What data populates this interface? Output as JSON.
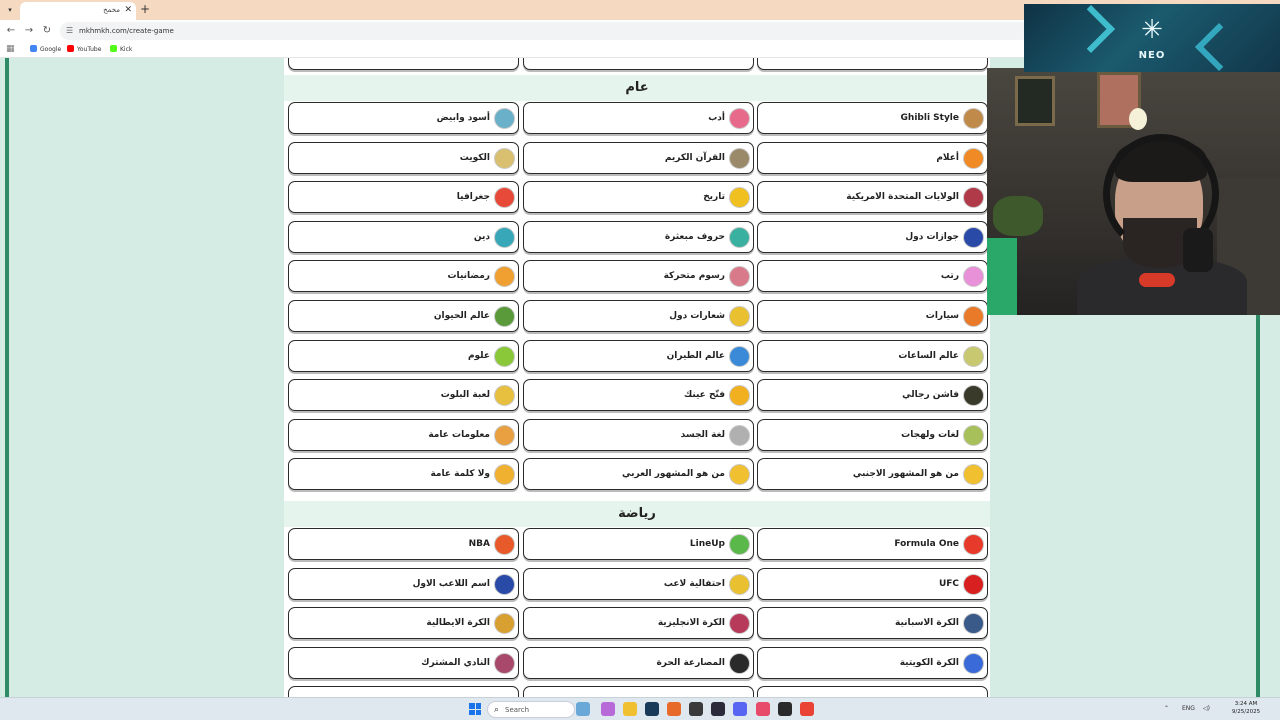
{
  "browser": {
    "tab_title": "مخمخ",
    "url": "mkhmkh.com/create-game",
    "bookmarks": [
      {
        "label": "Google",
        "color": "#4285f4"
      },
      {
        "label": "YouTube",
        "color": "#ff0000"
      },
      {
        "label": "Kick",
        "color": "#53fc18"
      }
    ]
  },
  "sections": [
    {
      "title": "عام",
      "cards": [
        {
          "label": "Ghibli Style",
          "icon": "ghibli-icon",
          "color": "#c08a4a"
        },
        {
          "label": "أدب",
          "icon": "literature-icon",
          "color": "#e86a8a"
        },
        {
          "label": "أسود وابيض",
          "icon": "black-white-icon",
          "color": "#6ab0c8"
        },
        {
          "label": "أعلام",
          "icon": "flags-icon",
          "color": "#f08a24"
        },
        {
          "label": "القرآن الكريم",
          "icon": "quran-icon",
          "color": "#9a8a6a"
        },
        {
          "label": "الكويت",
          "icon": "kuwait-icon",
          "color": "#d8c070"
        },
        {
          "label": "الولايات المتحدة الامريكية",
          "icon": "usa-flag-icon",
          "color": "#b03a48"
        },
        {
          "label": "تاريخ",
          "icon": "history-icon",
          "color": "#f0c020"
        },
        {
          "label": "جغرافيا",
          "icon": "geography-icon",
          "color": "#e84a3a"
        },
        {
          "label": "جوازات دول",
          "icon": "passport-icon",
          "color": "#2a4aa8"
        },
        {
          "label": "حروف مبعثرة",
          "icon": "letters-icon",
          "color": "#3ab0a0"
        },
        {
          "label": "دين",
          "icon": "religion-icon",
          "color": "#38a8b8"
        },
        {
          "label": "رتب",
          "icon": "ranks-icon",
          "color": "#e890d8"
        },
        {
          "label": "رسوم متحركة",
          "icon": "cartoon-icon",
          "color": "#d87a8a"
        },
        {
          "label": "رمضانيات",
          "icon": "ramadan-icon",
          "color": "#f0a030"
        },
        {
          "label": "سيارات",
          "icon": "cars-icon",
          "color": "#e87a2a"
        },
        {
          "label": "شعارات دول",
          "icon": "country-logos-icon",
          "color": "#e8c030"
        },
        {
          "label": "عالم الحيوان",
          "icon": "animals-icon",
          "color": "#5a9a3a"
        },
        {
          "label": "عالم الساعات",
          "icon": "watches-icon",
          "color": "#c8c870"
        },
        {
          "label": "عالم الطيران",
          "icon": "aviation-icon",
          "color": "#3a8ad8"
        },
        {
          "label": "علوم",
          "icon": "science-icon",
          "color": "#8ac83a"
        },
        {
          "label": "فاشن رجالي",
          "icon": "mens-fashion-icon",
          "color": "#3a3a2a"
        },
        {
          "label": "فتّح عينك",
          "icon": "open-eyes-icon",
          "color": "#f0b020"
        },
        {
          "label": "لعبة البلوت",
          "icon": "baloot-icon",
          "color": "#e8c040"
        },
        {
          "label": "لغات ولهجات",
          "icon": "languages-icon",
          "color": "#a8c05a"
        },
        {
          "label": "لغة الجسد",
          "icon": "body-language-icon",
          "color": "#b0b0b0"
        },
        {
          "label": "معلومات عامة",
          "icon": "general-info-icon",
          "color": "#e8a040"
        },
        {
          "label": "من هو المشهور الاجنبي",
          "icon": "foreign-celebrity-icon",
          "color": "#f0c030"
        },
        {
          "label": "من هو المشهور العربي",
          "icon": "arab-celebrity-icon",
          "color": "#f0c030"
        },
        {
          "label": "ولا كلمة عامة",
          "icon": "charades-icon",
          "color": "#f0b030"
        }
      ]
    },
    {
      "title": "رياضة",
      "cards": [
        {
          "label": "Formula One",
          "icon": "formula-one-icon",
          "color": "#e83a2a"
        },
        {
          "label": "LineUp",
          "icon": "lineup-icon",
          "color": "#5ab84a"
        },
        {
          "label": "NBA",
          "icon": "nba-icon",
          "color": "#e85a2a"
        },
        {
          "label": "UFC",
          "icon": "ufc-icon",
          "color": "#d82020"
        },
        {
          "label": "احتفالية لاعب",
          "icon": "celebration-icon",
          "color": "#e8c030"
        },
        {
          "label": "اسم اللاعب الاول",
          "icon": "first-player-icon",
          "color": "#2a4aa8"
        },
        {
          "label": "الكرة الاسبانية",
          "icon": "spanish-football-icon",
          "color": "#3a5a8a"
        },
        {
          "label": "الكرة الانجليزية",
          "icon": "english-football-icon",
          "color": "#b83a5a"
        },
        {
          "label": "الكرة الايطالية",
          "icon": "italian-football-icon",
          "color": "#d8a030"
        },
        {
          "label": "الكرة الكويتية",
          "icon": "kuwaiti-football-icon",
          "color": "#3a6ad8"
        },
        {
          "label": "المصارعة الحرة",
          "icon": "wrestling-icon",
          "color": "#2a2a2a"
        },
        {
          "label": "النادي المشترك",
          "icon": "shared-club-icon",
          "color": "#a8486a"
        }
      ]
    }
  ],
  "overlay": {
    "sponsor": "NEO"
  },
  "taskbar": {
    "search_label": "Search",
    "lang": "ENG",
    "time": "3:24 AM",
    "date": "9/25/2025"
  }
}
